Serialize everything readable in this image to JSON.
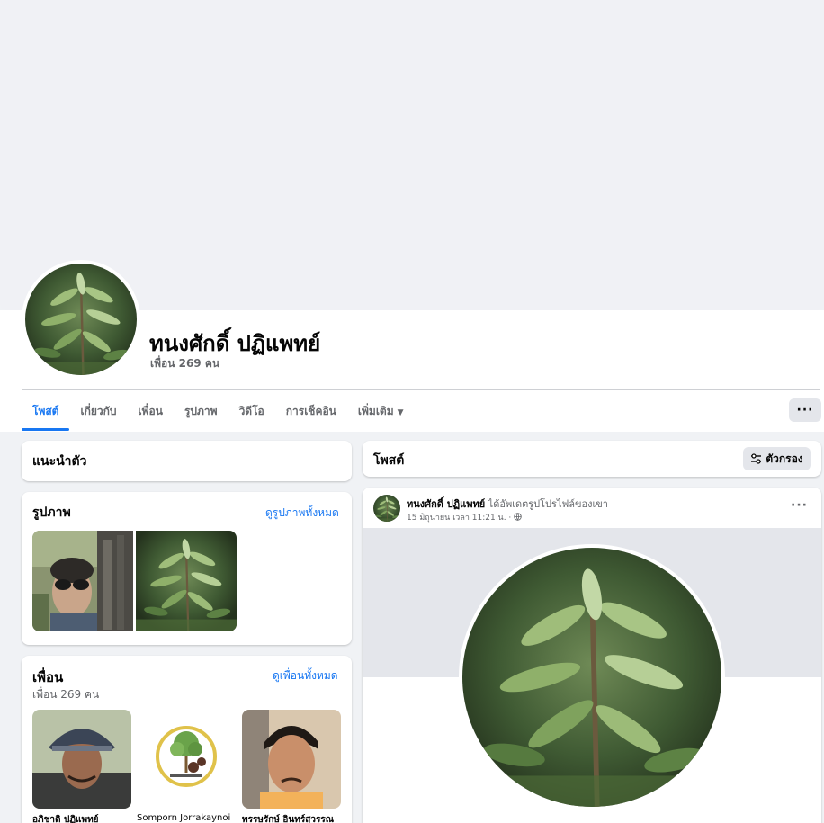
{
  "profile": {
    "name": "ทนงศักดิ์ ปฏิแพทย์",
    "friends_count": "เพื่อน 269 คน"
  },
  "tabs": [
    {
      "label": "โพสต์",
      "active": true
    },
    {
      "label": "เกี่ยวกับ"
    },
    {
      "label": "เพื่อน"
    },
    {
      "label": "รูปภาพ"
    },
    {
      "label": "วิดีโอ"
    },
    {
      "label": "การเช็คอิน"
    },
    {
      "label": "เพิ่มเติม",
      "caret": "▼"
    }
  ],
  "more_button": "···",
  "intro": {
    "title": "แนะนำตัว"
  },
  "photos": {
    "title": "รูปภาพ",
    "see_all": "ดูรูปภาพทั้งหมด"
  },
  "friends": {
    "title": "เพื่อน",
    "count": "เพื่อน 269 คน",
    "see_all": "ดูเพื่อนทั้งหมด",
    "items": [
      {
        "name": "อภิชาติ ปฏิแพทย์"
      },
      {
        "name": "Somporn Jorrakaynoi"
      },
      {
        "name": "พรรษรักษ์ อินทร์สุวรรณ"
      }
    ]
  },
  "posts": {
    "title": "โพสต์",
    "filter_label": "ตัวกรอง",
    "post": {
      "author": "ทนงศักดิ์ ปฏิแพทย์",
      "action": " ได้อัพเดตรูปโปรไฟล์ของเขา",
      "time": "15 มิถุนายน เวลา 11:21 น. · ",
      "privacy_icon": "globe-icon",
      "dots": "···"
    }
  },
  "colors": {
    "accent": "#1877f2",
    "background": "#f0f2f5",
    "secondary_text": "#65676b"
  }
}
